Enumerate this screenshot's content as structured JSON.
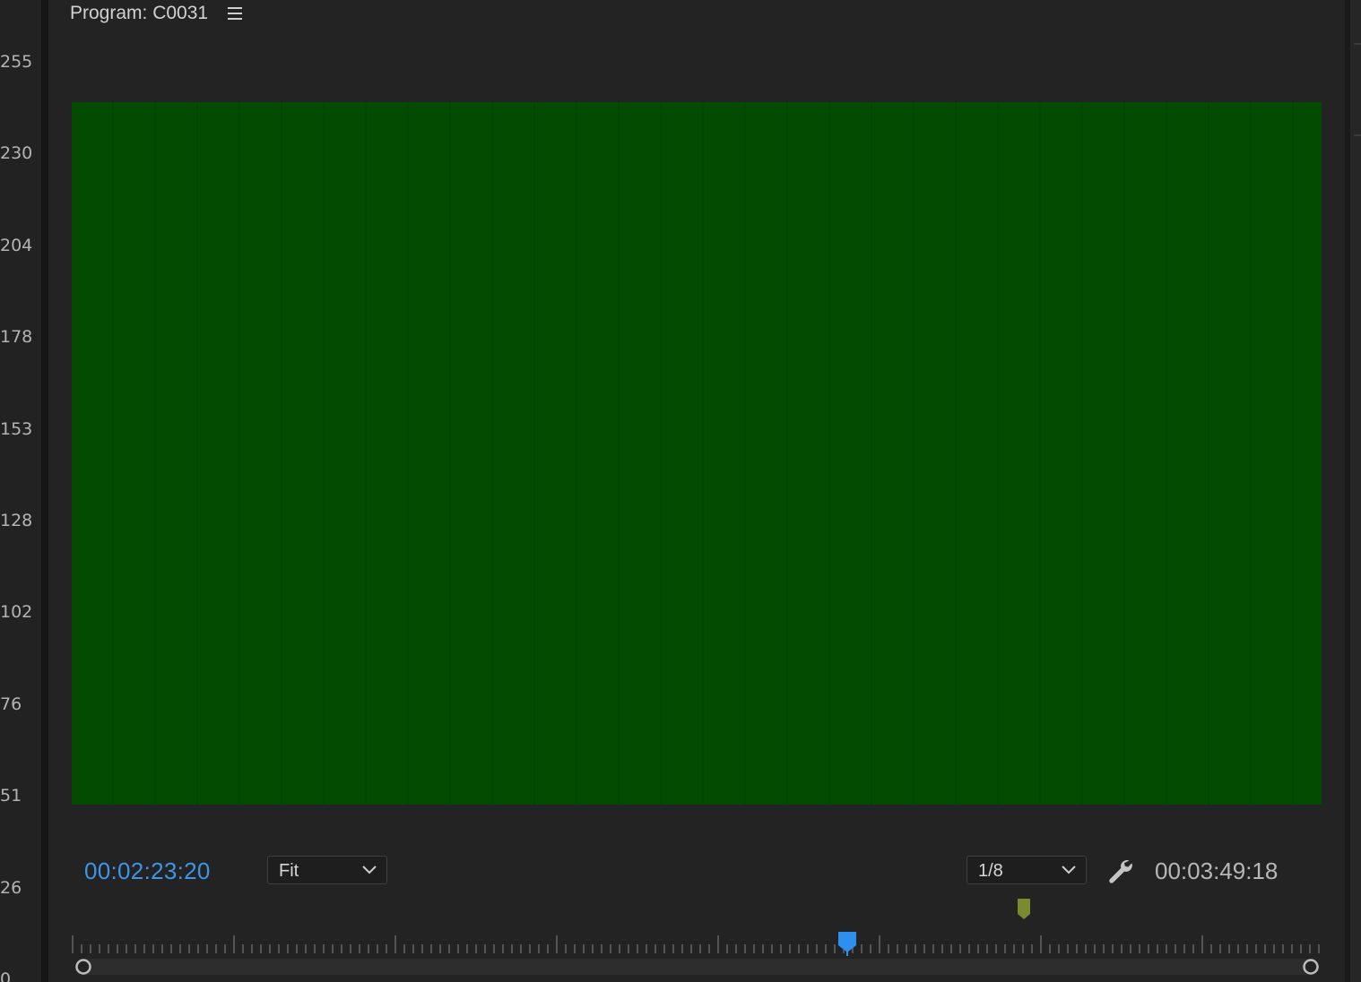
{
  "scope_scale": {
    "labels": [
      "255",
      "230",
      "204",
      "178",
      "153",
      "128",
      "102",
      "76",
      "51",
      "26",
      "0"
    ]
  },
  "panel": {
    "title": "Program: C0031",
    "menu_icon": "hamburger-menu-icon"
  },
  "video_frame": {
    "color": "#024b00"
  },
  "transport": {
    "current_timecode": "00:02:23:20",
    "current_timecode_color": "#3d95e8",
    "zoom_dropdown": {
      "selected": "Fit"
    },
    "resolution_dropdown": {
      "selected": "1/8"
    },
    "settings_icon": "wrench-icon",
    "duration_timecode": "00:03:49:18"
  },
  "timeline": {
    "playhead_color": "#2f8fee",
    "marker_color": "#7a8a2e",
    "playhead_position_fraction": 0.625
  }
}
